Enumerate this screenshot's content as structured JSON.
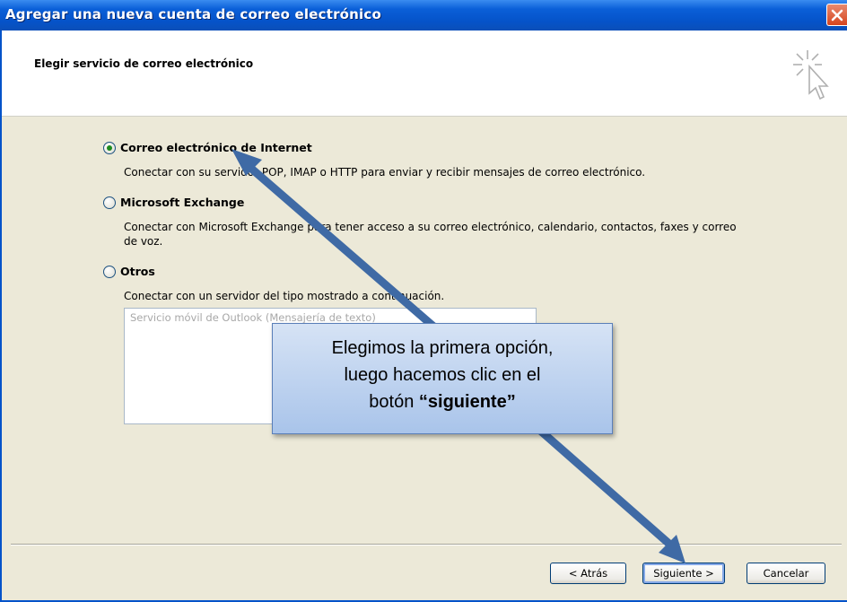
{
  "window": {
    "title": "Agregar una nueva cuenta de correo electrónico"
  },
  "header": {
    "title": "Elegir servicio de correo electrónico",
    "icon": "wizard-cursor-icon"
  },
  "options": [
    {
      "label": "Correo electrónico de Internet",
      "description": "Conectar con su servidor POP, IMAP o HTTP para enviar y recibir mensajes de correo electrónico.",
      "checked": true
    },
    {
      "label": "Microsoft Exchange",
      "description_line1": "Conectar con Microsoft Exchange para tener acceso a su correo electrónico, calendario, contactos, faxes y correo",
      "description_line2": "de voz.",
      "checked": false
    },
    {
      "label": "Otros",
      "description": "Conectar con un servidor del tipo mostrado a continuación.",
      "checked": false
    }
  ],
  "listbox": {
    "items": [
      "Servicio móvil de Outlook (Mensajería de texto)"
    ]
  },
  "buttons": {
    "back": "< Atrás",
    "next": "Siguiente >",
    "cancel": "Cancelar"
  },
  "callout": {
    "line1": "Elegimos la primera opción,",
    "line2": "luego hacemos clic en el",
    "line3_prefix": "botón ",
    "line3_bold": "“siguiente”"
  },
  "colors": {
    "titlebar": "#0553c9",
    "dialog_bg": "#ECE9D8",
    "callout_bg": "#a9c4ea",
    "arrow": "#3f6aa5"
  }
}
